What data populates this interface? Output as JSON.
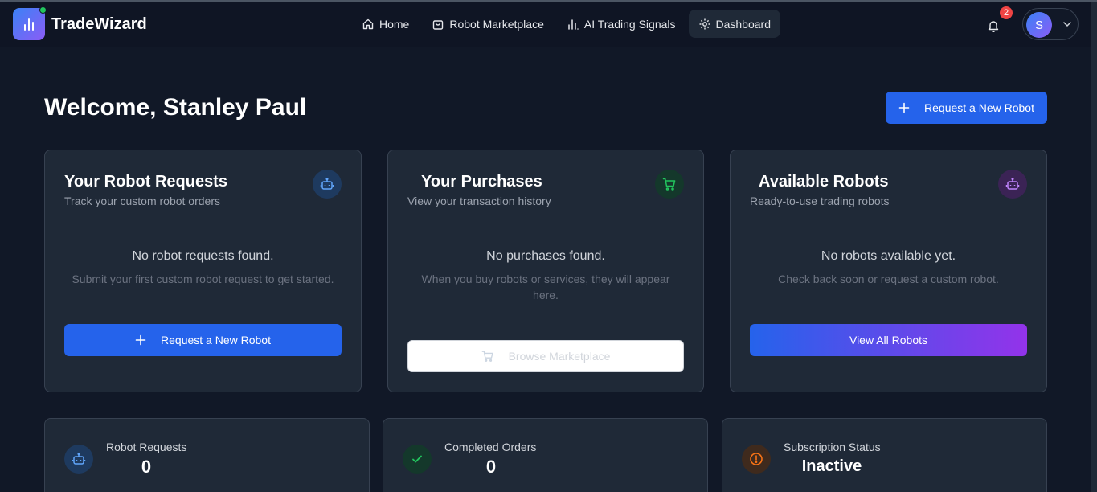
{
  "brand": {
    "name": "TradeWizard"
  },
  "nav": {
    "items": [
      {
        "label": "Home",
        "icon": "home-icon"
      },
      {
        "label": "Robot Marketplace",
        "icon": "shopping-bag-icon"
      },
      {
        "label": "AI Trading Signals",
        "icon": "bar-chart-icon"
      },
      {
        "label": "Dashboard",
        "icon": "gear-icon"
      }
    ],
    "active": "Dashboard"
  },
  "header": {
    "notifications_count": "2",
    "avatar_initial": "S"
  },
  "main": {
    "welcome": "Welcome, Stanley Paul",
    "request_button": "Request a New Robot"
  },
  "cards": [
    {
      "title": "Your Robot Requests",
      "subtitle": "Track your custom robot orders",
      "icon": "robot-icon",
      "empty_title": "No robot requests found.",
      "empty_sub": "Submit your first custom robot request to get started.",
      "button": "Request a New Robot"
    },
    {
      "title": "Your Purchases",
      "subtitle": "View your transaction history",
      "icon": "shopping-cart-icon",
      "empty_title": "No purchases found.",
      "empty_sub": "When you buy robots or services, they will appear here.",
      "button": "Browse Marketplace"
    },
    {
      "title": "Available Robots",
      "subtitle": "Ready-to-use trading robots",
      "icon": "robot-icon",
      "empty_title": "No robots available yet.",
      "empty_sub": "Check back soon or request a custom robot.",
      "button": "View All Robots"
    }
  ],
  "stats": [
    {
      "label": "Robot Requests",
      "value": "0",
      "icon": "robot-icon"
    },
    {
      "label": "Completed Orders",
      "value": "0",
      "icon": "check-icon"
    },
    {
      "label": "Subscription Status",
      "value": "Inactive",
      "icon": "alert-circle-icon"
    }
  ],
  "colors": {
    "background": "#111827",
    "card": "#1f2937",
    "primary": "#2563eb",
    "accent_purple": "#9333ea",
    "success": "#22c55e",
    "danger": "#ef4444",
    "warning": "#f97316"
  }
}
